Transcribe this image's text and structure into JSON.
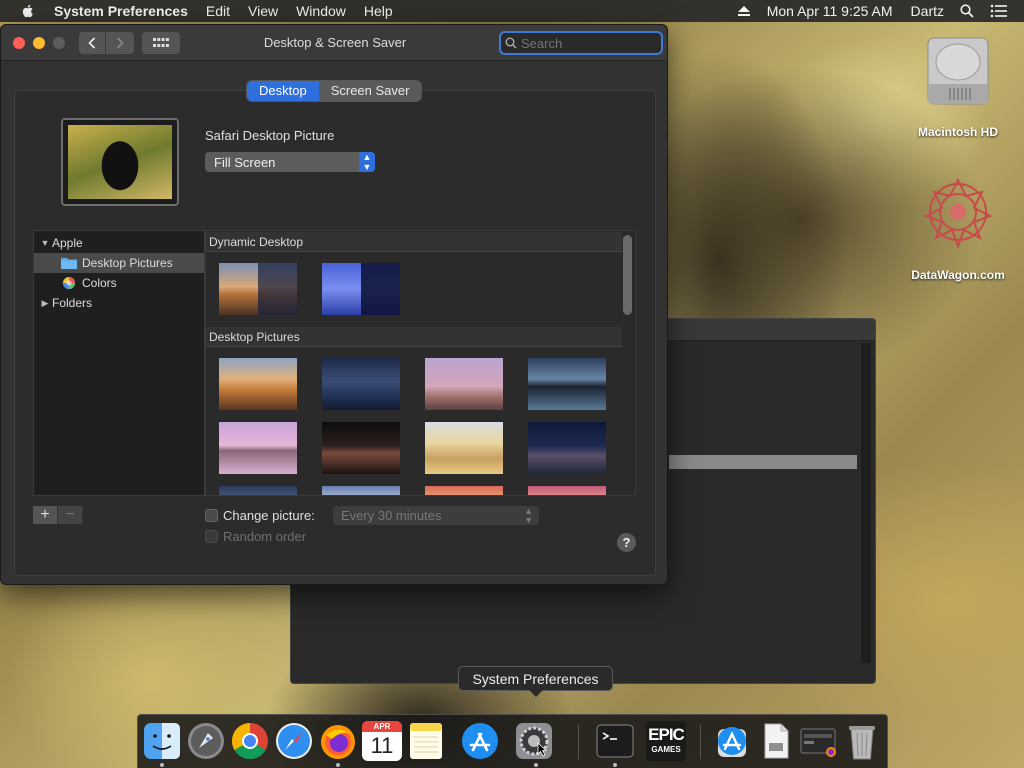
{
  "menubar": {
    "app_name": "System Preferences",
    "items": [
      "Edit",
      "View",
      "Window",
      "Help"
    ],
    "clock": "Mon Apr 11  9:25 AM",
    "user": "Dartz"
  },
  "desktop_icons": [
    {
      "label": "Macintosh HD",
      "icon": "hard-drive-icon"
    },
    {
      "label": "DataWagon.com",
      "icon": "datawagon-logo-icon"
    }
  ],
  "window": {
    "title": "Desktop & Screen Saver",
    "search_placeholder": "Search",
    "tabs": [
      "Desktop",
      "Screen Saver"
    ],
    "active_tab": "Desktop",
    "picture_name": "Safari Desktop Picture",
    "fill_mode": "Fill Screen",
    "sources": {
      "apple": "Apple",
      "desktop_pictures": "Desktop Pictures",
      "colors": "Colors",
      "folders": "Folders"
    },
    "sections": {
      "dynamic": "Dynamic Desktop",
      "pictures": "Desktop Pictures"
    },
    "change_picture_label": "Change picture:",
    "interval": "Every 30 minutes",
    "random_order_label": "Random order",
    "help": "?"
  },
  "tooltip": "System Preferences",
  "dock": [
    {
      "name": "Finder",
      "icon": "finder-icon"
    },
    {
      "name": "Launchpad",
      "icon": "launchpad-icon"
    },
    {
      "name": "Google Chrome",
      "icon": "chrome-icon"
    },
    {
      "name": "Safari",
      "icon": "safari-icon"
    },
    {
      "name": "Firefox",
      "icon": "firefox-icon"
    },
    {
      "name": "Calendar",
      "icon": "calendar-icon",
      "month": "APR",
      "day": "11"
    },
    {
      "name": "Notes",
      "icon": "notes-icon"
    },
    {
      "name": "App Store",
      "icon": "app-store-icon"
    },
    {
      "name": "System Preferences",
      "icon": "system-preferences-icon"
    },
    {
      "name": "Terminal",
      "icon": "terminal-icon"
    },
    {
      "name": "Epic Games",
      "icon": "epic-games-icon",
      "text1": "EPIC",
      "text2": "GAMES"
    },
    {
      "name": "Downloads",
      "icon": "downloads-stack-icon"
    },
    {
      "name": "Document",
      "icon": "document-icon"
    },
    {
      "name": "Screenshots",
      "icon": "screenshot-stack-icon"
    },
    {
      "name": "Trash",
      "icon": "trash-icon"
    }
  ]
}
